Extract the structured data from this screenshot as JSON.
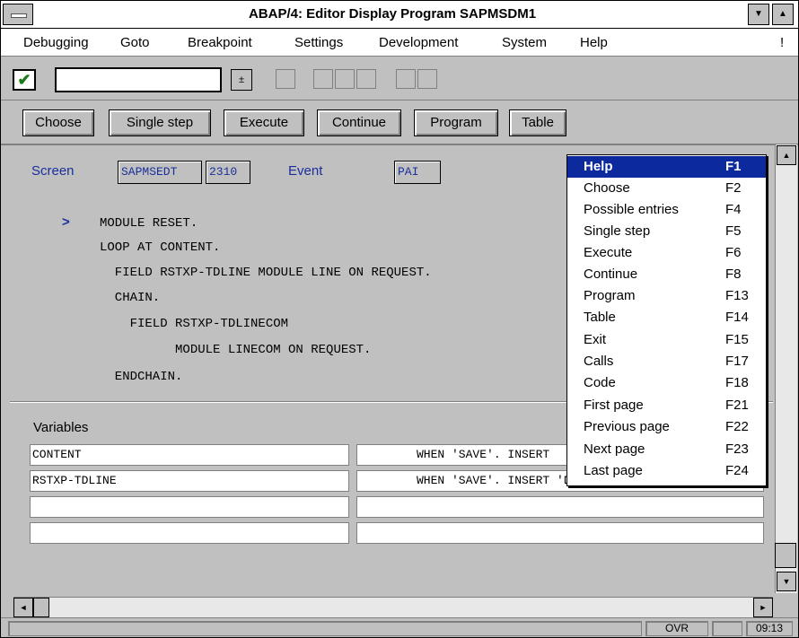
{
  "window": {
    "title": "ABAP/4: Editor Display Program SAPMSDM1",
    "minimize_glyph": "▼",
    "maximize_glyph": "▲",
    "trailing_glyph": "!"
  },
  "menubar": [
    "Debugging",
    "Goto",
    "Breakpoint",
    "Settings",
    "Development",
    "System",
    "Help"
  ],
  "toolbar": {
    "command_value": "",
    "dropdown_glyph": "±"
  },
  "buttons": [
    "Choose",
    "Single step",
    "Execute",
    "Continue",
    "Program",
    "Table"
  ],
  "screen_info": {
    "screen_label": "Screen",
    "screen_program": "SAPMSEDT",
    "screen_number": "2310",
    "event_label": "Event",
    "event_value": "PAI"
  },
  "code": {
    "current_marker": ">",
    "lines": [
      "MODULE RESET.",
      "LOOP AT CONTENT.",
      "  FIELD RSTXP-TDLINE MODULE LINE ON REQUEST.",
      "  CHAIN.",
      "    FIELD RSTXP-TDLINECOM",
      "          MODULE LINECOM ON REQUEST.",
      "  ENDCHAIN."
    ]
  },
  "variables": {
    "label": "Variables",
    "rows": [
      {
        "name": "CONTENT",
        "value": "WHEN 'SAVE'. INSERT"
      },
      {
        "name": "RSTXP-TDLINE",
        "value": "WHEN 'SAVE'. INSERT 'DOSAV'."
      },
      {
        "name": "",
        "value": ""
      },
      {
        "name": "",
        "value": ""
      }
    ]
  },
  "popup_menu": [
    {
      "label": "Help",
      "key": "F1",
      "selected": true
    },
    {
      "label": "Choose",
      "key": "F2"
    },
    {
      "label": "Possible entries",
      "key": "F4"
    },
    {
      "label": "Single step",
      "key": "F5"
    },
    {
      "label": "Execute",
      "key": "F6"
    },
    {
      "label": "Continue",
      "key": "F8"
    },
    {
      "label": "Program",
      "key": "F13"
    },
    {
      "label": "Table",
      "key": "F14"
    },
    {
      "label": "Exit",
      "key": "F15"
    },
    {
      "label": "Calls",
      "key": "F17"
    },
    {
      "label": "Code",
      "key": "F18"
    },
    {
      "label": "First page",
      "key": "F21"
    },
    {
      "label": "Previous page",
      "key": "F22"
    },
    {
      "label": "Next page",
      "key": "F23"
    },
    {
      "label": "Last page",
      "key": "F24"
    }
  ],
  "scroll_glyphs": {
    "up": "▲",
    "down": "▼",
    "left": "◄",
    "right": "►"
  },
  "status": {
    "mode": "OVR",
    "time": "09:13"
  },
  "colors": {
    "selection": "#0c2a9e",
    "label_blue": "#1a2f9c",
    "check_green": "#1a7a1a"
  }
}
